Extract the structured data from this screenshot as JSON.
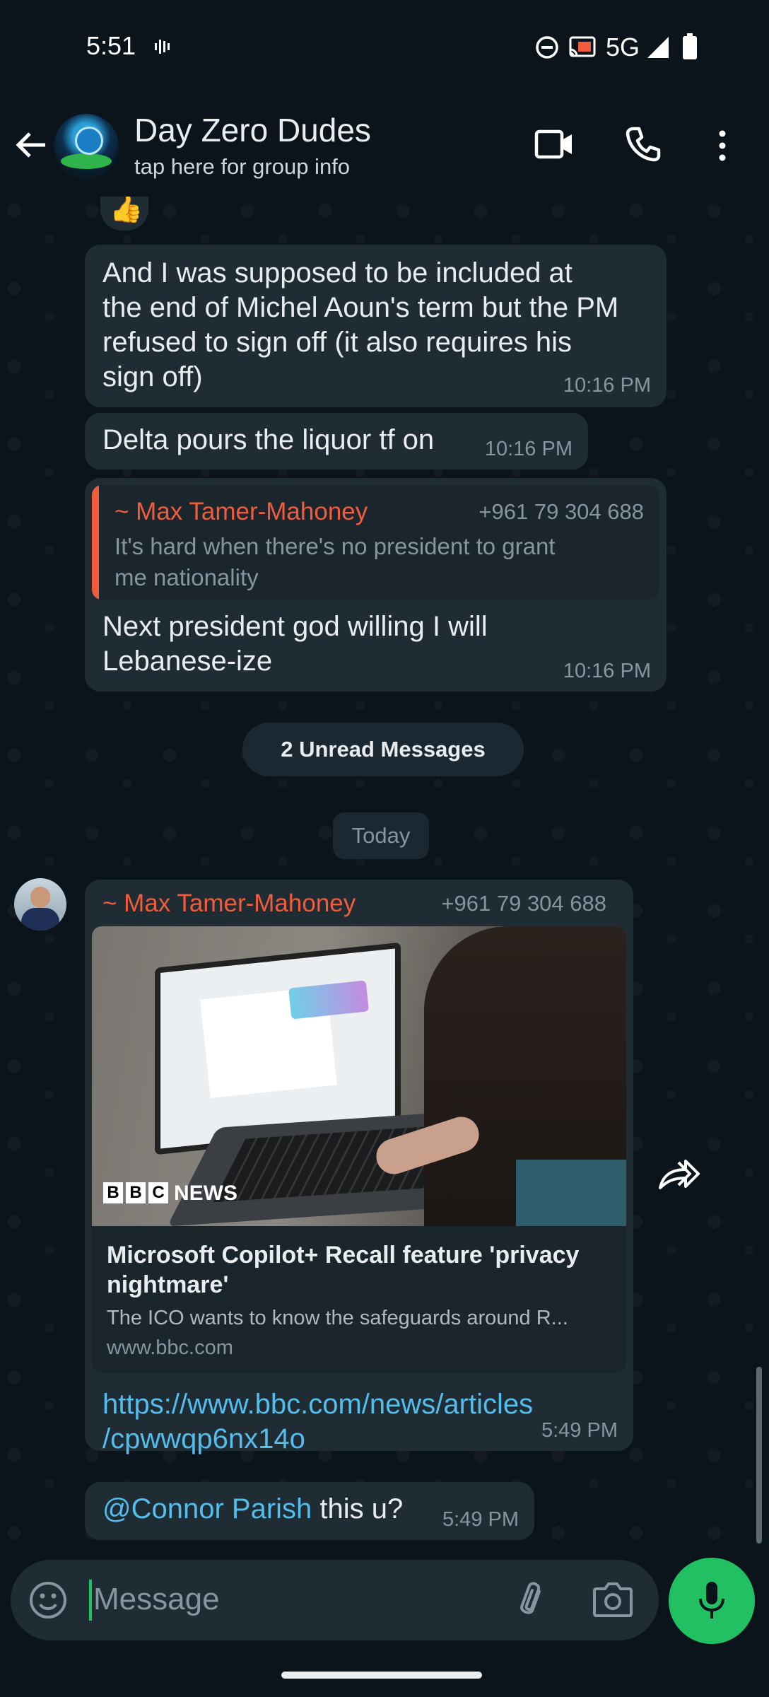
{
  "status": {
    "time": "5:51",
    "network": "5G"
  },
  "header": {
    "title": "Day Zero Dudes",
    "subtitle": "tap here for group info"
  },
  "messages": {
    "emoji_reaction": "👍",
    "m1": {
      "lines": [
        "And I was supposed to be included at",
        "the end of Michel Aoun's term but the PM",
        "refused to sign off (it also requires his",
        "sign off)"
      ],
      "time": "10:16 PM"
    },
    "m2": {
      "text": "Delta pours the liquor tf on",
      "time": "10:16 PM"
    },
    "m3": {
      "quote_sender": "~ Max Tamer-Mahoney",
      "quote_phone": "+961 79 304 688",
      "quote_lines": [
        "It's hard when there's no president to grant",
        "me nationality"
      ],
      "lines": [
        "Next president god willing I will",
        "Lebanese-ize"
      ],
      "time": "10:16 PM"
    }
  },
  "separators": {
    "unread": "2 Unread Messages",
    "day": "Today"
  },
  "link_message": {
    "sender": "~ Max Tamer-Mahoney",
    "phone": "+961 79 304 688",
    "image_brand": "NEWS",
    "preview_title_lines": [
      "Microsoft Copilot+ Recall feature 'privacy",
      "nightmare'"
    ],
    "preview_desc": "The ICO wants to know the safeguards around R...",
    "preview_domain": "www.bbc.com",
    "url_lines": [
      "https://www.bbc.com/news/articles",
      "/cpwwqp6nx14o"
    ],
    "time": "5:49 PM"
  },
  "last_message": {
    "mention": "@Connor Parish",
    "text": " this u?",
    "time": "5:49 PM"
  },
  "composer": {
    "placeholder": "Message"
  },
  "colors": {
    "background": "#0b141a",
    "bubble": "#1f2c34",
    "sender_accent": "#f15c3c",
    "link": "#53bdeb",
    "mic": "#21c063"
  }
}
